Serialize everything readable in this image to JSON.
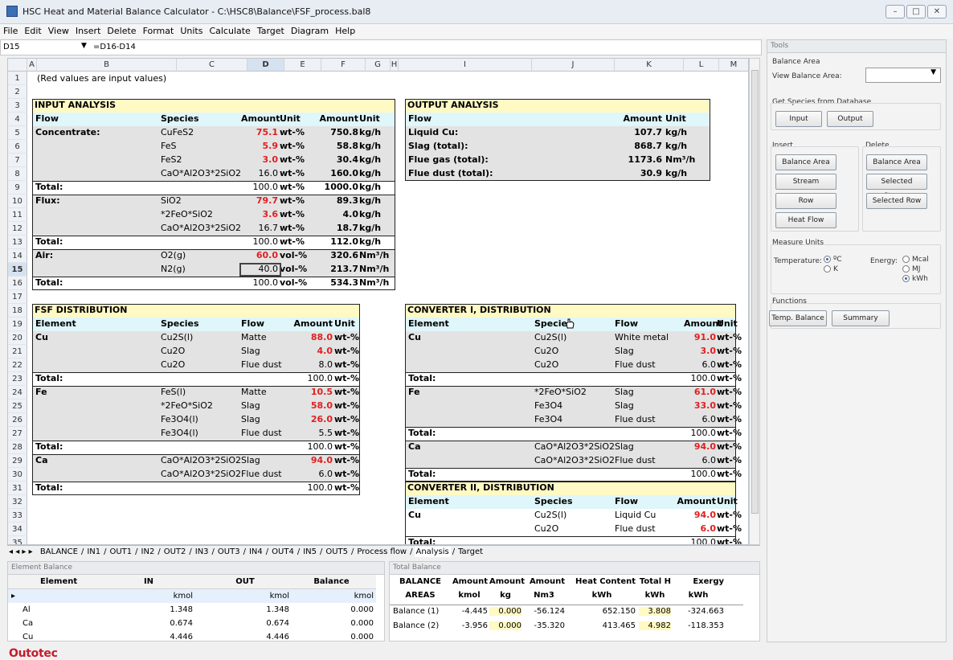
{
  "window": {
    "title": "HSC Heat and Material Balance Calculator - C:\\HSC8\\Balance\\FSF_process.bal8"
  },
  "menu": [
    "File",
    "Edit",
    "View",
    "Insert",
    "Delete",
    "Format",
    "Units",
    "Calculate",
    "Target",
    "Diagram",
    "Help"
  ],
  "formula_bar": {
    "cell_ref": "D15",
    "formula": "=D16-D14"
  },
  "columns": [
    "A",
    "B",
    "C",
    "D",
    "E",
    "F",
    "G",
    "H",
    "I",
    "J",
    "K",
    "L",
    "M"
  ],
  "rows": [
    "1",
    "2",
    "3",
    "4",
    "5",
    "6",
    "7",
    "8",
    "9",
    "10",
    "11",
    "12",
    "13",
    "14",
    "15",
    "16",
    "17",
    "18",
    "19",
    "20",
    "21",
    "22",
    "23",
    "24",
    "25",
    "26",
    "27",
    "28",
    "29",
    "30",
    "31",
    "32",
    "33",
    "34",
    "35"
  ],
  "note": "(Red values are input values)",
  "input": {
    "title": "INPUT ANALYSIS",
    "headers": [
      "Flow",
      "Species",
      "Amount",
      "Unit",
      "Amount",
      "Unit"
    ],
    "rows": [
      [
        "Concentrate:",
        "CuFeS2",
        "75.1",
        "wt-%",
        "750.8",
        "kg/h"
      ],
      [
        "",
        "FeS",
        "5.9",
        "wt-%",
        "58.8",
        "kg/h"
      ],
      [
        "",
        "FeS2",
        "3.0",
        "wt-%",
        "30.4",
        "kg/h"
      ],
      [
        "",
        "CaO*Al2O3*2SiO2",
        "16.0",
        "wt-%",
        "160.0",
        "kg/h"
      ],
      [
        "Total:",
        "",
        "100.0",
        "wt-%",
        "1000.0",
        "kg/h"
      ],
      [
        "Flux:",
        "SiO2",
        "79.7",
        "wt-%",
        "89.3",
        "kg/h"
      ],
      [
        "",
        "*2FeO*SiO2",
        "3.6",
        "wt-%",
        "4.0",
        "kg/h"
      ],
      [
        "",
        "CaO*Al2O3*2SiO2",
        "16.7",
        "wt-%",
        "18.7",
        "kg/h"
      ],
      [
        "Total:",
        "",
        "100.0",
        "wt-%",
        "112.0",
        "kg/h"
      ],
      [
        "Air:",
        "O2(g)",
        "60.0",
        "vol-%",
        "320.6",
        "Nm³/h"
      ],
      [
        "",
        "N2(g)",
        "40.0",
        "vol-%",
        "213.7",
        "Nm³/h"
      ],
      [
        "Total:",
        "",
        "100.0",
        "vol-%",
        "534.3",
        "Nm³/h"
      ]
    ]
  },
  "output": {
    "title": "OUTPUT ANALYSIS",
    "headers": [
      "Flow",
      "Amount",
      "Unit"
    ],
    "rows": [
      [
        "Liquid Cu:",
        "107.7",
        "kg/h"
      ],
      [
        "Slag (total):",
        "868.7",
        "kg/h"
      ],
      [
        "Flue gas (total):",
        "1173.6",
        "Nm³/h"
      ],
      [
        "Flue dust (total):",
        "30.9",
        "kg/h"
      ]
    ]
  },
  "fsf": {
    "title": "FSF DISTRIBUTION",
    "headers": [
      "Element",
      "Species",
      "Flow",
      "Amount",
      "Unit"
    ],
    "rows": [
      [
        "Cu",
        "Cu2S(l)",
        "Matte",
        "88.0",
        "wt-%"
      ],
      [
        "",
        "Cu2O",
        "Slag",
        "4.0",
        "wt-%"
      ],
      [
        "",
        "Cu2O",
        "Flue dust",
        "8.0",
        "wt-%"
      ],
      [
        "Total:",
        "",
        "",
        "100.0",
        "wt-%"
      ],
      [
        "Fe",
        "FeS(l)",
        "Matte",
        "10.5",
        "wt-%"
      ],
      [
        "",
        "*2FeO*SiO2",
        "Slag",
        "58.0",
        "wt-%"
      ],
      [
        "",
        "Fe3O4(l)",
        "Slag",
        "26.0",
        "wt-%"
      ],
      [
        "",
        "Fe3O4(l)",
        "Flue dust",
        "5.5",
        "wt-%"
      ],
      [
        "Total:",
        "",
        "",
        "100.0",
        "wt-%"
      ],
      [
        "Ca",
        "CaO*Al2O3*2SiO2",
        "Slag",
        "94.0",
        "wt-%"
      ],
      [
        "",
        "CaO*Al2O3*2SiO2",
        "Flue dust",
        "6.0",
        "wt-%"
      ],
      [
        "Total:",
        "",
        "",
        "100.0",
        "wt-%"
      ]
    ]
  },
  "conv1": {
    "title": "CONVERTER I, DISTRIBUTION",
    "headers": [
      "Element",
      "Species",
      "Flow",
      "Amount",
      "Unit"
    ],
    "rows": [
      [
        "Cu",
        "Cu2S(l)",
        "White metal",
        "91.0",
        "wt-%"
      ],
      [
        "",
        "Cu2O",
        "Slag",
        "3.0",
        "wt-%"
      ],
      [
        "",
        "Cu2O",
        "Flue dust",
        "6.0",
        "wt-%"
      ],
      [
        "Total:",
        "",
        "",
        "100.0",
        "wt-%"
      ],
      [
        "Fe",
        "*2FeO*SiO2",
        "Slag",
        "61.0",
        "wt-%"
      ],
      [
        "",
        "Fe3O4",
        "Slag",
        "33.0",
        "wt-%"
      ],
      [
        "",
        "Fe3O4",
        "Flue dust",
        "6.0",
        "wt-%"
      ],
      [
        "Total:",
        "",
        "",
        "100.0",
        "wt-%"
      ],
      [
        "Ca",
        "CaO*Al2O3*2SiO2",
        "Slag",
        "94.0",
        "wt-%"
      ],
      [
        "",
        "CaO*Al2O3*2SiO2",
        "Flue dust",
        "6.0",
        "wt-%"
      ],
      [
        "Total:",
        "",
        "",
        "100.0",
        "wt-%"
      ]
    ]
  },
  "conv2": {
    "title": "CONVERTER II, DISTRIBUTION",
    "headers": [
      "Element",
      "Species",
      "Flow",
      "Amount",
      "Unit"
    ],
    "rows": [
      [
        "Cu",
        "Cu2S(l)",
        "Liquid Cu",
        "94.0",
        "wt-%"
      ],
      [
        "",
        "Cu2O",
        "Flue dust",
        "6.0",
        "wt-%"
      ],
      [
        "Total:",
        "",
        "",
        "100.0",
        "wt-%"
      ]
    ]
  },
  "sheet_tabs": [
    "BALANCE",
    "IN1",
    "OUT1",
    "IN2",
    "OUT2",
    "IN3",
    "OUT3",
    "IN4",
    "OUT4",
    "IN5",
    "OUT5",
    "Process flow",
    "Analysis",
    "Target"
  ],
  "tools": {
    "title": "Tools",
    "balance_area_group": "Balance Area",
    "view_balance_area_label": "View Balance Area:",
    "get_species_group": "Get Species from Database",
    "input_btn": "Input",
    "output_btn": "Output",
    "insert_group": "Insert",
    "delete_group": "Delete",
    "ins_balance_area": "Balance Area",
    "ins_stream": "Stream",
    "ins_row": "Row",
    "ins_heat_flow": "Heat Flow",
    "del_balance_area": "Balance Area",
    "del_stream": "Selected Stream",
    "del_row": "Selected Row",
    "measure_group": "Measure Units",
    "temperature_label": "Temperature:",
    "temp_c": "ºC",
    "temp_k": "K",
    "energy_label": "Energy:",
    "energy_mcal": "Mcal",
    "energy_mj": "MJ",
    "energy_kwh": "kWh",
    "functions_group": "Functions",
    "temp_balance_btn": "Temp. Balance",
    "summary_btn": "Summary"
  },
  "element_balance": {
    "title": "Element Balance",
    "headers": [
      "Element",
      "IN",
      "OUT",
      "Balance"
    ],
    "units": [
      "kmol",
      "kmol",
      "kmol"
    ],
    "rows": [
      [
        "Al",
        "1.348",
        "1.348",
        "0.000"
      ],
      [
        "Ca",
        "0.674",
        "0.674",
        "0.000"
      ],
      [
        "Cu",
        "4.446",
        "4.446",
        "0.000"
      ]
    ]
  },
  "total_balance": {
    "title": "Total Balance",
    "headers": [
      "BALANCE",
      "Amount",
      "Amount",
      "Amount",
      "Heat Content",
      "Total H",
      "Exergy"
    ],
    "subheaders": [
      "AREAS",
      "kmol",
      "kg",
      "Nm3",
      "kWh",
      "kWh",
      "kWh"
    ],
    "rows": [
      [
        "Balance (1)",
        "-4.445",
        "0.000",
        "-56.124",
        "652.150",
        "3.808",
        "-324.663"
      ],
      [
        "Balance (2)",
        "-3.956",
        "0.000",
        "-35.320",
        "413.465",
        "4.982",
        "-118.353"
      ]
    ]
  },
  "footer": {
    "logo": "Outotec"
  },
  "colors": {
    "red_input": "#e02020",
    "yellow_header": "#fff9c4",
    "cyan_header": "#dff6fb",
    "gray_row": "#e3e3e3",
    "logo": "#c51b2c"
  }
}
